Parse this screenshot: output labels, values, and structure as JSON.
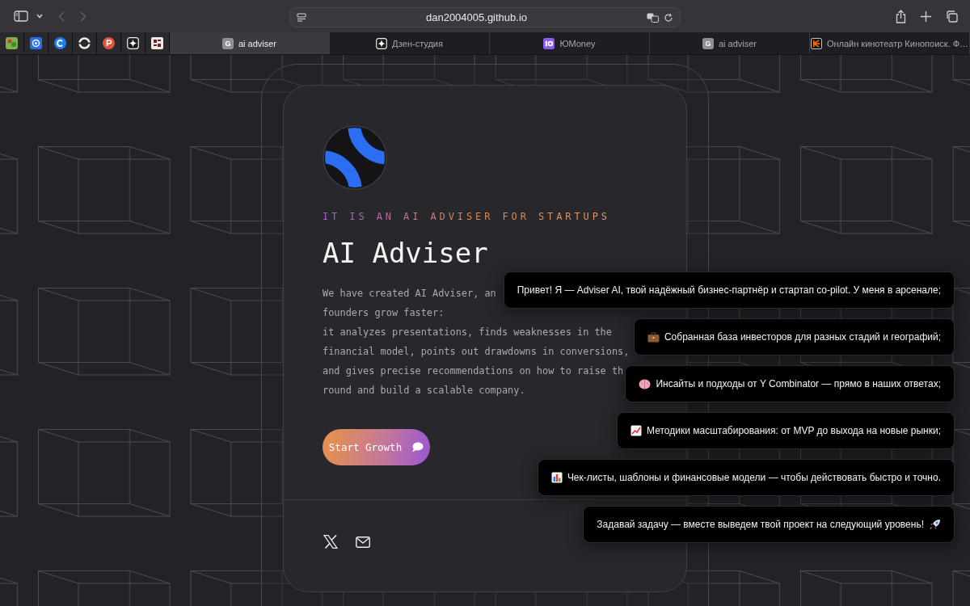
{
  "browser": {
    "url": "dan2004005.github.io",
    "back_disabled": true,
    "forward_disabled": true,
    "pinned_tabs": [
      {
        "kind": "dots"
      },
      {
        "kind": "at"
      },
      {
        "kind": "c"
      },
      {
        "kind": "ring"
      },
      {
        "kind": "p"
      },
      {
        "kind": "sparkle"
      },
      {
        "kind": "grid"
      }
    ],
    "tabs": [
      {
        "label": "ai adviser",
        "kind": "letter",
        "letter": "G",
        "selected": true
      },
      {
        "label": "Дзен-студия",
        "kind": "sparkle",
        "selected": false
      },
      {
        "label": "ЮMoney",
        "kind": "money",
        "selected": false
      },
      {
        "label": "ai adviser",
        "kind": "letter",
        "letter": "G",
        "selected": false
      },
      {
        "label": "Онлайн кинотеатр Кинопоиск. Ф…",
        "kind": "cinema",
        "selected": false
      }
    ]
  },
  "hero": {
    "tagline": "IT IS AN AI ADVISER FOR STARTUPS",
    "title": "AI Adviser",
    "paragraph": [
      "We have created AI Adviser, an",
      "founders grow faster:",
      "it analyzes presentations, finds weaknesses in the",
      "financial model, points out drawdowns in conversions,",
      "and gives precise recommendations on how to raise th",
      "round and build a scalable company."
    ],
    "button": "Start Growth",
    "socials": [
      {
        "kind": "x"
      },
      {
        "kind": "mail"
      }
    ]
  },
  "chat": {
    "messages": [
      {
        "text": "Привет! Я — Adviser AI, твой надёжный бизнес-партнёр и стартап co-pilot. У меня в арсенале;",
        "kind": "plain"
      },
      {
        "text": "Собранная база инвесторов для разных стадий и географий;",
        "kind": "briefcase"
      },
      {
        "text": "Инсайты и подходы от Y Combinator — прямо в наших ответах;",
        "kind": "brain"
      },
      {
        "text": "Методики масштабирования: от MVP до выхода на новые рынки;",
        "kind": "trend"
      },
      {
        "text": "Чек-листы, шаблоны и финансовые модели — чтобы действовать быстро и точно.",
        "kind": "bars"
      },
      {
        "text": "Задавай задачу — вместе выведем твой проект на следующий уровень!",
        "kind": "rocket"
      }
    ]
  }
}
